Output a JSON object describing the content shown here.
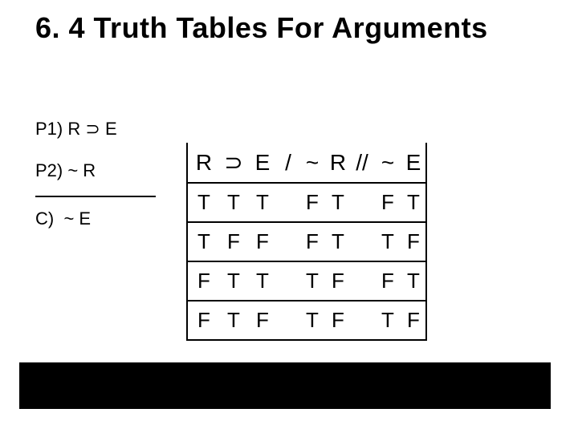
{
  "title": "6. 4 Truth Tables For Arguments",
  "premises": {
    "p1_label": "P1) R",
    "p1_sup": "⊃",
    "p1_rhs": "E",
    "p2": "P2) ~ R",
    "c": "C)  ~ E"
  },
  "header": {
    "R": "R",
    "sup": "⊃",
    "E": "E",
    "slash": "/",
    "neg1": "~",
    "R2": "R",
    "dslash": "//",
    "neg2": "~",
    "E2": "E"
  },
  "chart_data": {
    "type": "table",
    "title": "Truth table for R ⊃ E / ~R // ~E",
    "columns": [
      "R",
      "⊃",
      "E",
      "~",
      "R (of ~R)",
      "~",
      "E (of ~E)"
    ],
    "rows": [
      {
        "R": "T",
        "sup": "T",
        "E": "T",
        "nR_neg": "F",
        "nR_R": "T",
        "nE_neg": "F",
        "nE_E": "T"
      },
      {
        "R": "T",
        "sup": "F",
        "E": "F",
        "nR_neg": "F",
        "nR_R": "T",
        "nE_neg": "T",
        "nE_E": "F"
      },
      {
        "R": "F",
        "sup": "T",
        "E": "T",
        "nR_neg": "T",
        "nR_R": "F",
        "nE_neg": "F",
        "nE_E": "T"
      },
      {
        "R": "F",
        "sup": "T",
        "E": "F",
        "nR_neg": "T",
        "nR_R": "F",
        "nE_neg": "T",
        "nE_E": "F"
      }
    ]
  }
}
